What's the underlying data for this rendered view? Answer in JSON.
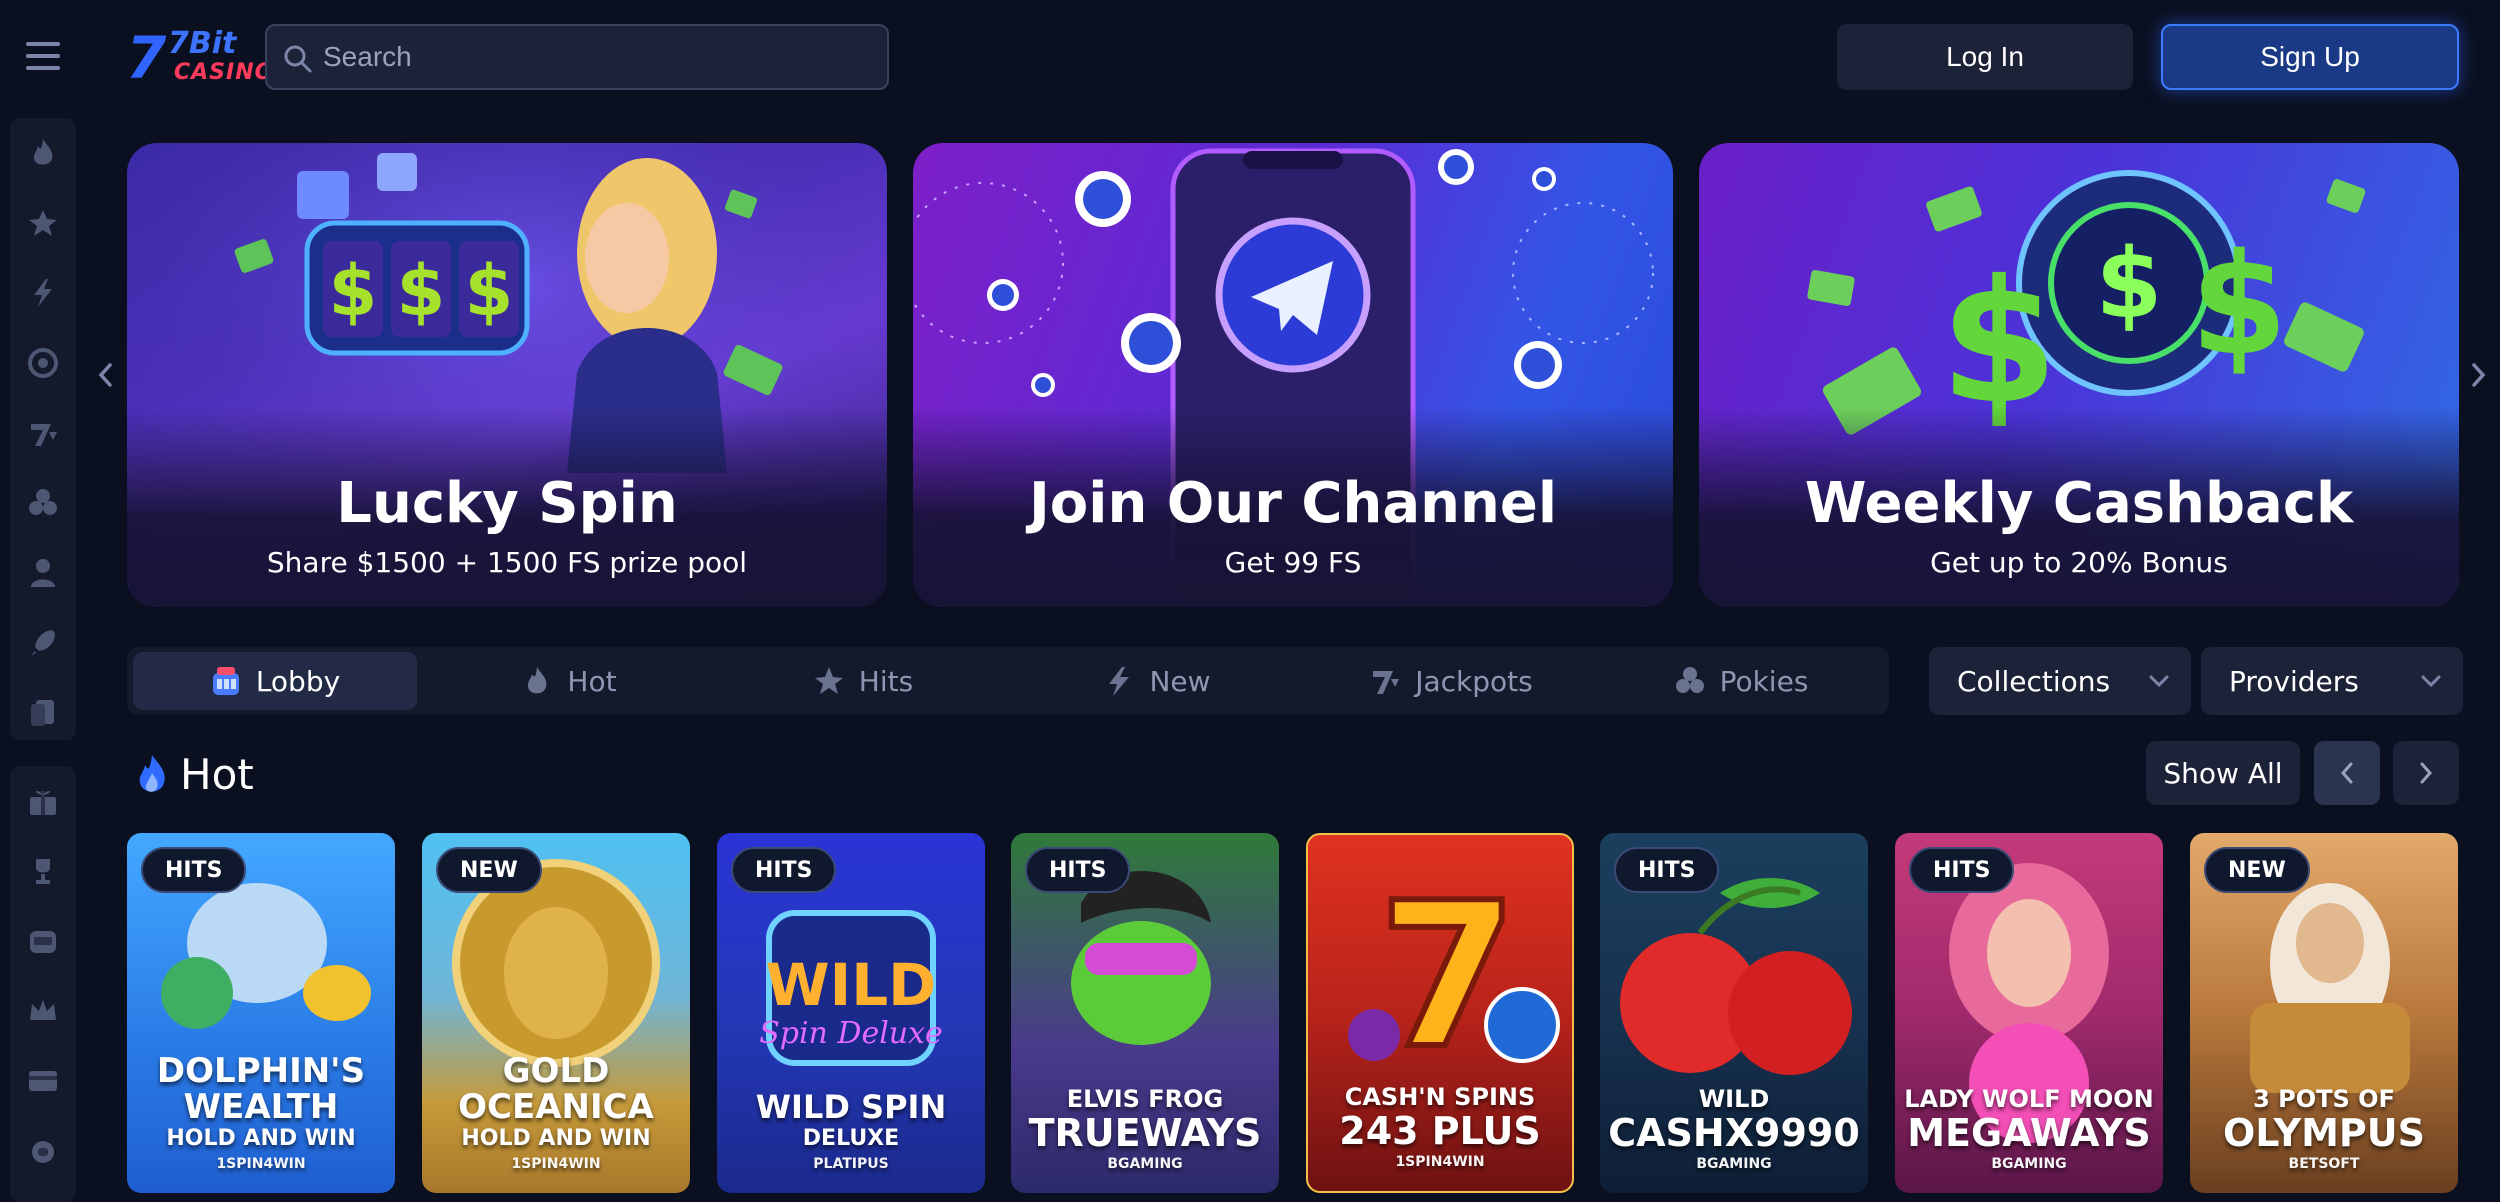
{
  "header": {
    "logo_text_top": "7Bit",
    "logo_text_bottom": "CASINO",
    "search_placeholder": "Search",
    "login_label": "Log In",
    "signup_label": "Sign Up"
  },
  "sidebar": {
    "group1": [
      "flame-icon",
      "star-icon",
      "lightning-icon",
      "target-icon",
      "jackpot-icon",
      "clover-icon",
      "dealer-icon",
      "rocket-icon",
      "cards-icon"
    ],
    "group2": [
      "gift-icon",
      "trophy-icon",
      "slot-machine-icon",
      "crown-icon",
      "credit-card-icon",
      "support-icon"
    ]
  },
  "banners": [
    {
      "title": "Lucky Spin",
      "subtitle": "Share $1500 + 1500 FS prize pool"
    },
    {
      "title": "Join Our Channel",
      "subtitle": "Get 99 FS"
    },
    {
      "title": "Weekly Cashback",
      "subtitle": "Get up to 20% Bonus"
    }
  ],
  "tabs": [
    {
      "label": "Lobby",
      "icon": "lobby-icon",
      "active": true
    },
    {
      "label": "Hot",
      "icon": "flame-icon"
    },
    {
      "label": "Hits",
      "icon": "star-icon"
    },
    {
      "label": "New",
      "icon": "lightning-icon"
    },
    {
      "label": "Jackpots",
      "icon": "jackpot-icon"
    },
    {
      "label": "Pokies",
      "icon": "clover-icon"
    }
  ],
  "filters": {
    "collections": "Collections",
    "providers": "Providers"
  },
  "section": {
    "title": "Hot",
    "show_all": "Show All"
  },
  "games": [
    {
      "badge": "HITS",
      "line1": "",
      "line2": "DOLPHIN'S WEALTH",
      "line3": "HOLD AND WIN",
      "provider": "1SPIN4WIN"
    },
    {
      "badge": "NEW",
      "line1": "",
      "line2": "GOLD OCEANICA",
      "line3": "HOLD AND WIN",
      "provider": "1SPIN4WIN"
    },
    {
      "badge": "HITS",
      "line1": "",
      "line2": "WILD SPIN",
      "line3": "DELUXE",
      "provider": "PLATIPUS"
    },
    {
      "badge": "HITS",
      "line1": "ELVIS FROG",
      "line2": "TRUEWAYS",
      "line3": "",
      "provider": "BGAMING"
    },
    {
      "badge": "",
      "line1": "CASH'N SPINS",
      "line2": "243 PLUS",
      "line3": "",
      "provider": "1SPIN4WIN"
    },
    {
      "badge": "HITS",
      "line1": "WILD",
      "line2": "CASHX9990",
      "line3": "",
      "provider": "BGAMING"
    },
    {
      "badge": "HITS",
      "line1": "LADY WOLF MOON",
      "line2": "MEGAWAYS",
      "line3": "",
      "provider": "BGAMING"
    },
    {
      "badge": "NEW",
      "line1": "3 POTS OF",
      "line2": "OLYMPUS",
      "line3": "",
      "provider": "BETSOFT"
    }
  ]
}
